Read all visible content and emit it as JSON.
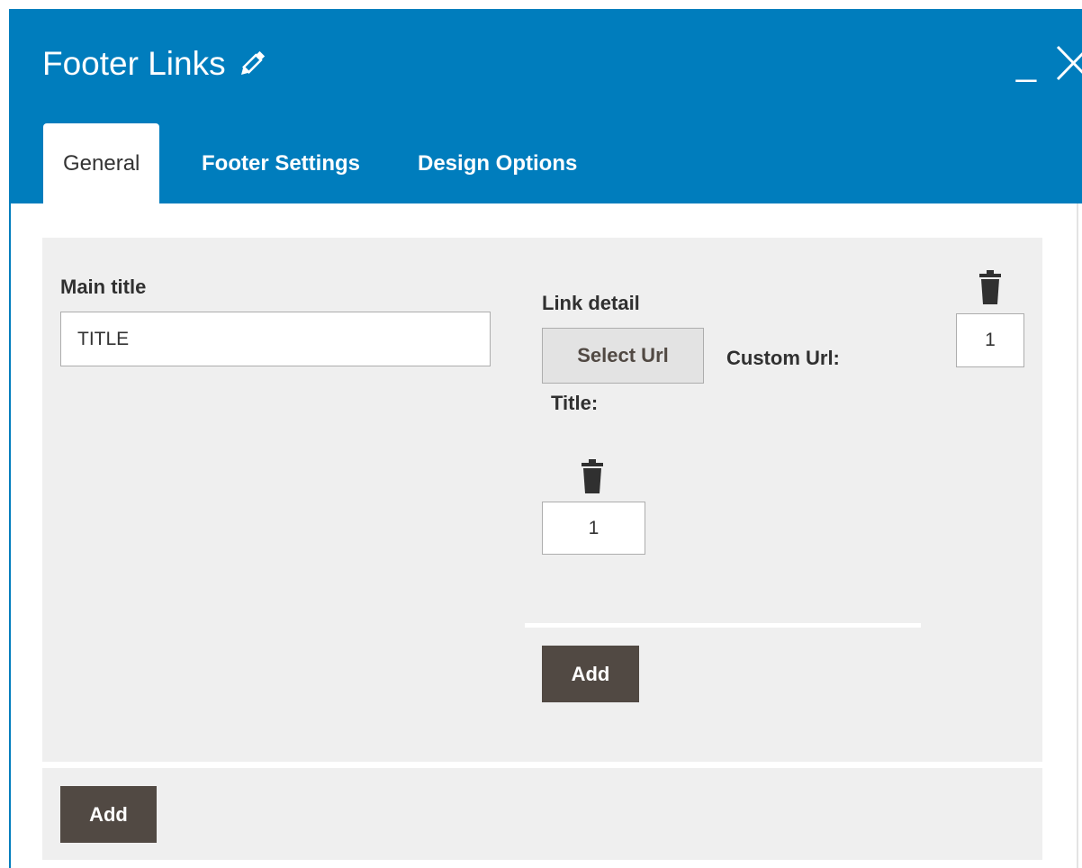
{
  "window": {
    "title": "Footer Links",
    "minimize_glyph": "_",
    "close_icon": "close-icon",
    "edit_icon": "pencil-icon"
  },
  "tabs": [
    {
      "label": "General",
      "active": true
    },
    {
      "label": "Footer Settings",
      "active": false
    },
    {
      "label": "Design Options",
      "active": false
    }
  ],
  "form": {
    "main_title_label": "Main title",
    "main_title_value": "TITLE",
    "link_detail_label": "Link detail",
    "select_url_label": "Select Url",
    "custom_url_label": "Custom Url:",
    "title_label": "Title:",
    "order_value_top": "1",
    "order_value_link": "1",
    "add_link_label": "Add",
    "add_item_label": "Add"
  },
  "colors": {
    "header_bg": "#007dbd",
    "panel_bg": "#efefef",
    "button_dark": "#514943"
  }
}
